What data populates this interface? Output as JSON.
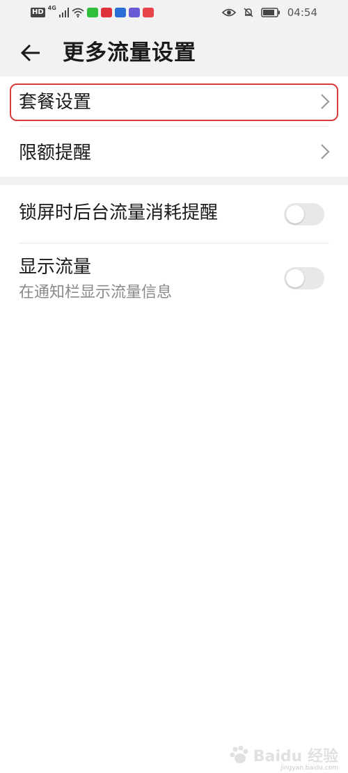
{
  "status_bar": {
    "hd_badge": "HD",
    "network_type": "4G",
    "time": "04:54",
    "icons": [
      "signal-icon",
      "wifi-icon",
      "iqiyi-app-icon",
      "weibo-app-icon",
      "browser-app-icon",
      "video-app-icon",
      "shop-app-icon",
      "eye-comfort-icon",
      "mute-bell-icon",
      "battery-icon"
    ],
    "app_colors": [
      "#2fbf3a",
      "#e0303a",
      "#2a6fd6",
      "#6a5ad6",
      "#e8454a"
    ]
  },
  "app_bar": {
    "title": "更多流量设置",
    "back_icon": "back-arrow-icon"
  },
  "settings": {
    "items": [
      {
        "label": "套餐设置",
        "type": "link",
        "highlighted": true
      },
      {
        "label": "限额提醒",
        "type": "link"
      },
      {
        "label": "锁屏时后台流量消耗提醒",
        "type": "toggle",
        "on": false
      },
      {
        "label": "显示流量",
        "subtitle": "在通知栏显示流量信息",
        "type": "toggle",
        "on": false
      }
    ]
  },
  "watermark": {
    "brand": "Baidu 经验",
    "url": "jingyan.baidu.com"
  },
  "colors": {
    "highlight_border": "#d93a3a",
    "header_bg": "#f2f2f2",
    "toggle_off": "#e8e8e8",
    "subtitle": "#8a8a8a"
  }
}
